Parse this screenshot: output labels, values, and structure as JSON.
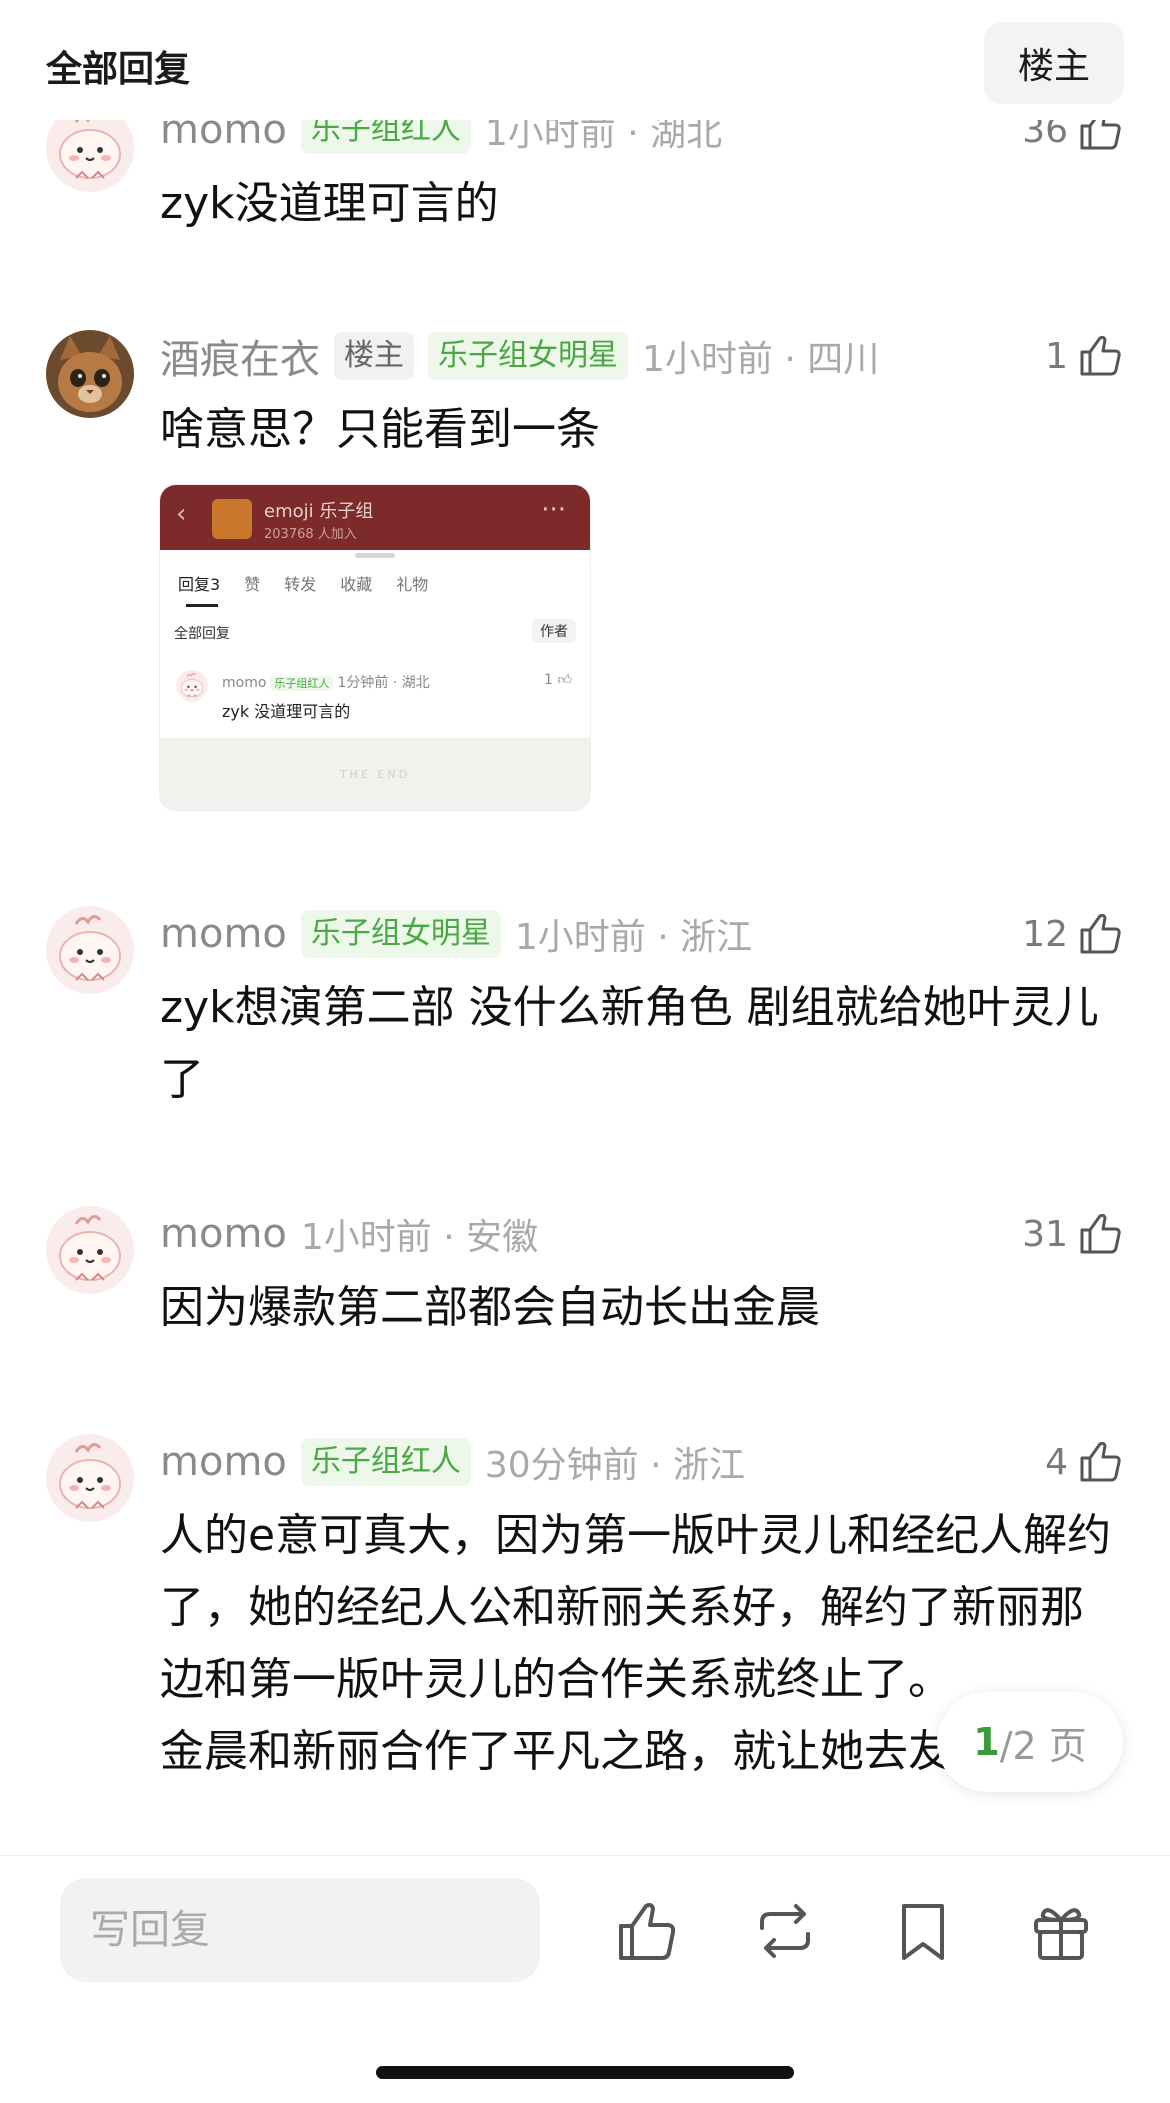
{
  "header": {
    "title": "全部回复",
    "op_button": "楼主"
  },
  "comments": [
    {
      "username": "momo",
      "badge": "乐子组红人",
      "time": "1小时前 · 湖北",
      "likes": "36",
      "text": "zyk没道理可言的"
    },
    {
      "username": "酒痕在衣",
      "op_tag": "楼主",
      "badge": "乐子组女明星",
      "time": "1小时前 · 四川",
      "likes": "1",
      "text": "啥意思？只能看到一条"
    },
    {
      "username": "momo",
      "badge": "乐子组女明星",
      "time": "1小时前 · 浙江",
      "likes": "12",
      "text": "zyk想演第二部 没什么新角色 剧组就给她叶灵儿了"
    },
    {
      "username": "momo",
      "time": "1小时前 · 安徽",
      "likes": "31",
      "text": "因为爆款第二部都会自动长出金晨"
    },
    {
      "username": "momo",
      "badge": "乐子组红人",
      "time": "30分钟前 · 浙江",
      "likes": "4",
      "text": "人的e意可真大，因为第一版叶灵儿和经纪人解约了，她的经纪人公和新丽关系好，解约了新丽那边和第一版叶灵儿的合作关系就终止了。\n金晨和新丽合作了平凡之路，就让她去友情"
    }
  ],
  "screenshot": {
    "group_name": "emoji 乐子组",
    "members": "203768 人加入",
    "tabs": [
      "回复3",
      "赞",
      "转发",
      "收藏",
      "礼物"
    ],
    "all_replies": "全部回复",
    "author_btn": "作者",
    "username": "momo",
    "badge": "乐子组红人",
    "time": "1分钟前 · 湖北",
    "likes": "1",
    "text": "zyk 没道理可言的",
    "end_text": "THE END"
  },
  "pager": {
    "current": "1",
    "total": "/2 页"
  },
  "bottom_bar": {
    "reply_placeholder": "写回复"
  },
  "icons": [
    "thumbs-up-icon",
    "repost-icon",
    "bookmark-icon",
    "gift-icon"
  ],
  "colors": {
    "badge_green": "#4aa844",
    "badge_bg": "#eef8ea",
    "pager_current": "#3c9a3a"
  }
}
